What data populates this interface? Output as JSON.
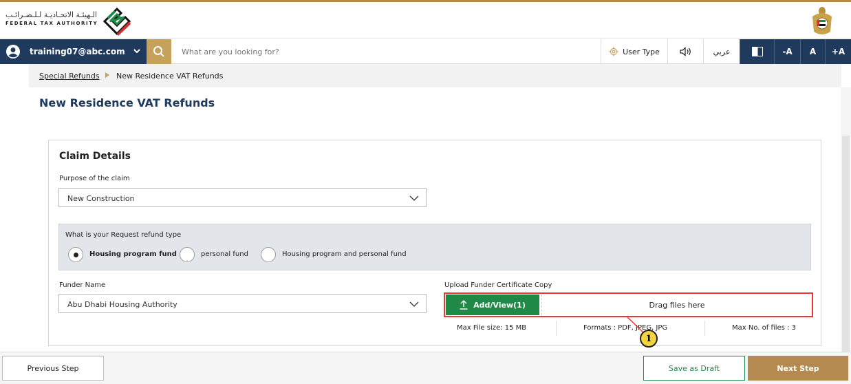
{
  "header": {
    "logo_arabic": "الـهيئـة الاتحـاديـة لـلـضـرائـب",
    "logo_english": "FEDERAL TAX AUTHORITY"
  },
  "toolbar": {
    "user_email": "training07@abc.com",
    "search_placeholder": "What are you looking for?",
    "user_type_label": "User Type",
    "arabic_label": "عربي",
    "font_decrease": "-A",
    "font_normal": "A",
    "font_increase": "+A"
  },
  "breadcrumb": {
    "parent": "Special Refunds",
    "current": "New Residence VAT Refunds"
  },
  "page": {
    "title": "New Residence VAT Refunds"
  },
  "claim": {
    "section_title": "Claim Details",
    "purpose_label": "Purpose of the claim",
    "purpose_value": "New Construction",
    "refund_question": "What is your Request refund type",
    "refund_options": [
      {
        "label": "Housing program fund",
        "selected": true
      },
      {
        "label": "personal fund",
        "selected": false
      },
      {
        "label": "Housing program and personal fund",
        "selected": false
      }
    ],
    "funder_label": "Funder Name",
    "funder_value": "Abu Dhabi Housing Authority",
    "upload_label": "Upload Funder Certificate Copy",
    "add_view_label": "Add/View(1)",
    "drag_label": "Drag files here",
    "max_size": "Max File size: 15 MB",
    "formats": "Formats : PDF, JPEG, JPG",
    "max_files": "Max No. of files : 3"
  },
  "callout": {
    "number": "1"
  },
  "footer": {
    "previous_label": "Previous Step",
    "draft_label": "Save as Draft",
    "next_label": "Next Step"
  },
  "colors": {
    "navy": "#1f3a5c",
    "gold": "#c6a15b",
    "green": "#1f8a48",
    "highlight": "#ee3333"
  }
}
